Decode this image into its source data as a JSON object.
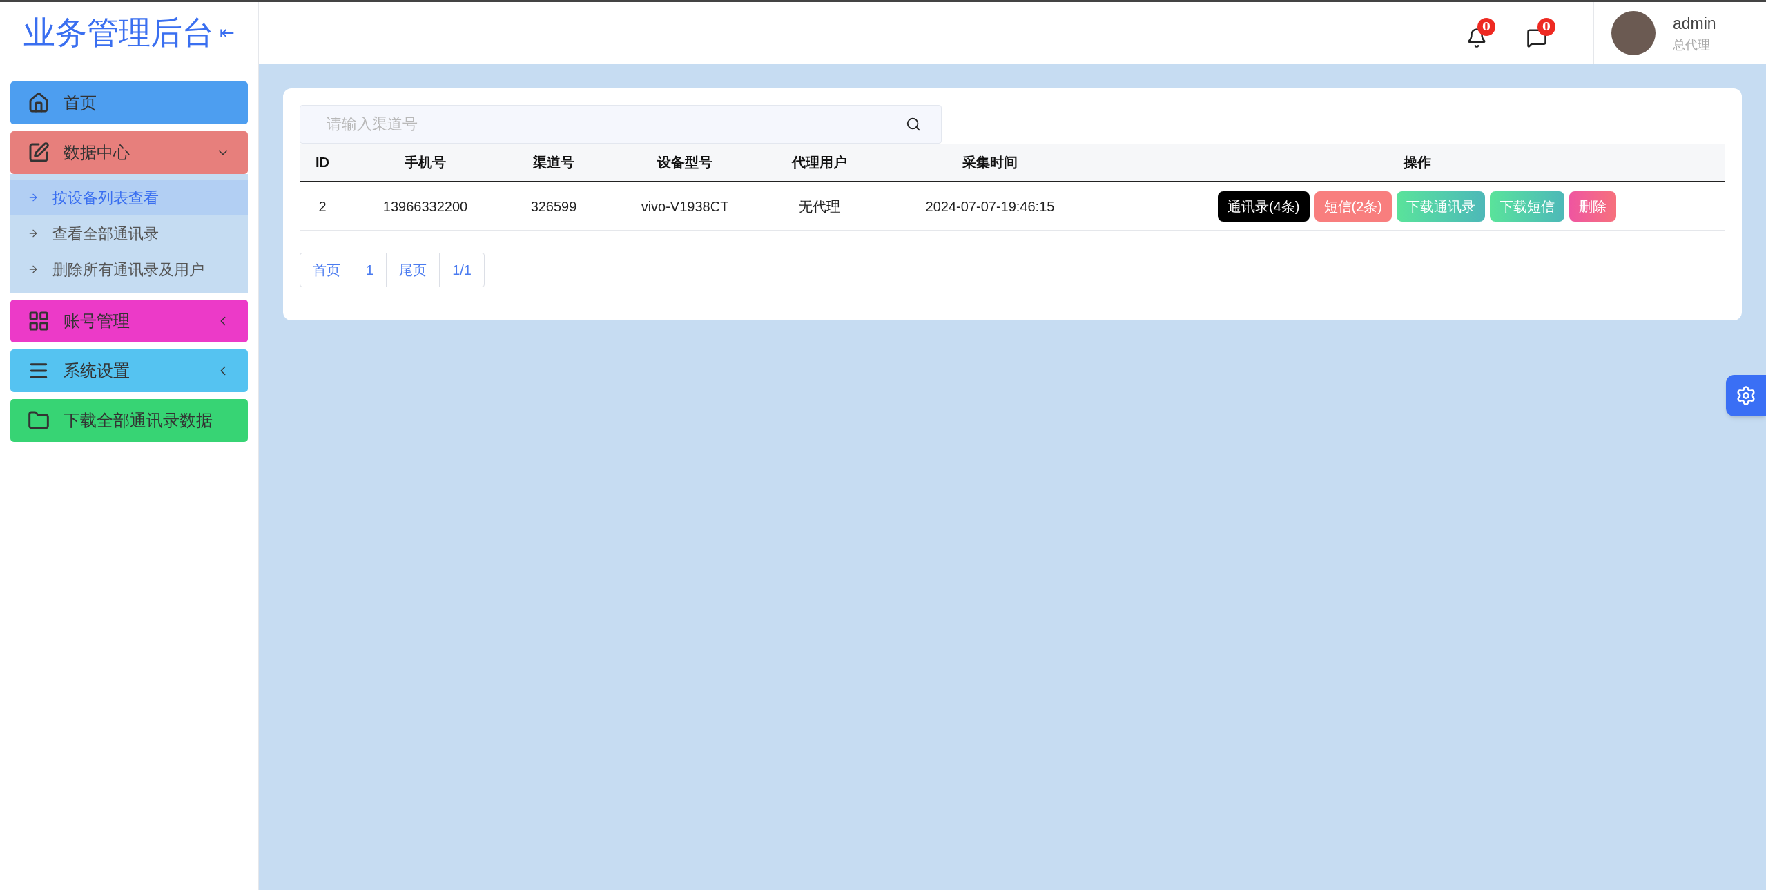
{
  "brand": {
    "title": "业务管理后台",
    "collapse_glyph": "⇤"
  },
  "sidebar": {
    "items": [
      {
        "label": "首页",
        "color": "#4d9ef0"
      },
      {
        "label": "数据中心",
        "color": "#e77f7c",
        "expanded": true,
        "children": [
          {
            "label": "按设备列表查看",
            "selected": true
          },
          {
            "label": "查看全部通讯录",
            "selected": false
          },
          {
            "label": "删除所有通讯录及用户",
            "selected": false
          }
        ]
      },
      {
        "label": "账号管理",
        "color": "#ec3ac8",
        "expanded": false
      },
      {
        "label": "系统设置",
        "color": "#55c3f1",
        "expanded": false
      },
      {
        "label": "下载全部通讯录数据",
        "color": "#37d474"
      }
    ]
  },
  "header": {
    "notifications": "0",
    "messages": "0",
    "user": {
      "name": "admin",
      "role": "总代理"
    }
  },
  "search": {
    "placeholder": "请输入渠道号"
  },
  "table": {
    "columns": [
      "ID",
      "手机号",
      "渠道号",
      "设备型号",
      "代理用户",
      "采集时间",
      "操作"
    ],
    "rows": [
      {
        "cells": [
          "2",
          "13966332200",
          "326599",
          "vivo-V1938CT",
          "无代理",
          "2024-07-07-19:46:15"
        ],
        "actions": [
          {
            "label": "通讯录(4条)",
            "kind": "dark"
          },
          {
            "label": "短信(2条)",
            "kind": "salmon"
          },
          {
            "label": "下载通讯录",
            "kind": "teal"
          },
          {
            "label": "下载短信",
            "kind": "teal"
          },
          {
            "label": "删除",
            "kind": "pink"
          }
        ]
      }
    ]
  },
  "pagination": [
    "首页",
    "1",
    "尾页",
    "1/1"
  ]
}
